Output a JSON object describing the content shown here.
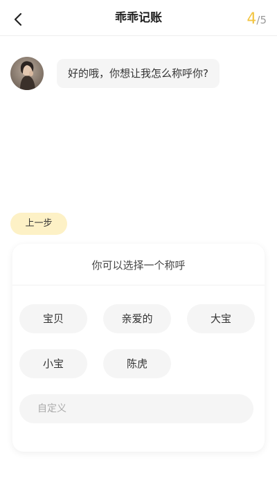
{
  "header": {
    "title": "乖乖记账",
    "progress_current": "4",
    "progress_total": "/5"
  },
  "chat": {
    "message": "好的哦，你想让我怎么称呼你?"
  },
  "prev_button": {
    "label": "上一步"
  },
  "selection_card": {
    "title": "你可以选择一个称呼",
    "options": [
      "宝贝",
      "亲爱的",
      "大宝",
      "小宝",
      "陈虎"
    ],
    "custom_placeholder": "自定义"
  },
  "colors": {
    "accent": "#f3c542",
    "prev_button_bg": "#fdf1c6",
    "chip_bg": "#f5f5f5"
  },
  "icons": {
    "back": "chevron-left-icon",
    "avatar": "assistant-avatar"
  }
}
